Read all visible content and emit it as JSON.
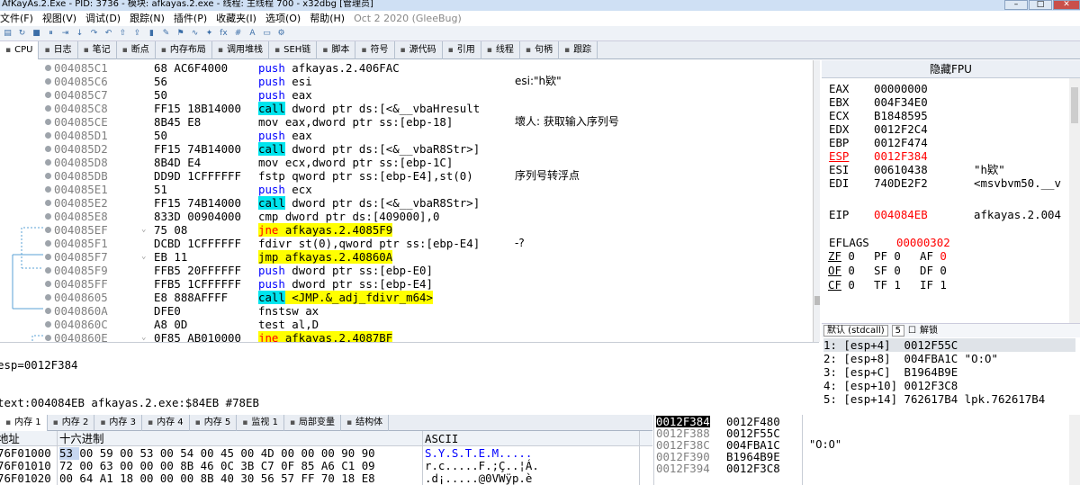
{
  "window": {
    "title": "AfKayAs.2.Exe - PID: 3736 - 模块: afkayas.2.exe - 线程: 主线程 700 - x32dbg [管理员]"
  },
  "menu": [
    "文件(F)",
    "视图(V)",
    "调试(D)",
    "跟踪(N)",
    "插件(P)",
    "收藏夹(I)",
    "选项(O)",
    "帮助(H)"
  ],
  "menu_date": "Oct 2 2020 (GleeBug)",
  "tabs": [
    {
      "label": "CPU",
      "icon": "cpu-icon"
    },
    {
      "label": "日志",
      "icon": "log-icon"
    },
    {
      "label": "笔记",
      "icon": "notes-icon"
    },
    {
      "label": "断点",
      "icon": "breakpoint-icon"
    },
    {
      "label": "内存布局",
      "icon": "memory-map-icon"
    },
    {
      "label": "调用堆栈",
      "icon": "call-stack-icon"
    },
    {
      "label": "SEH链",
      "icon": "seh-icon"
    },
    {
      "label": "脚本",
      "icon": "script-icon"
    },
    {
      "label": "符号",
      "icon": "symbol-icon"
    },
    {
      "label": "源代码",
      "icon": "source-icon"
    },
    {
      "label": "引用",
      "icon": "reference-icon"
    },
    {
      "label": "线程",
      "icon": "thread-icon"
    },
    {
      "label": "句柄",
      "icon": "handle-icon"
    },
    {
      "label": "跟踪",
      "icon": "trace-icon"
    }
  ],
  "disasm": [
    {
      "addr": "004085C1",
      "bytes": "68 AC6F4000",
      "kw": "push",
      "kwc": "kw-push",
      "ops": "afkayas.2.406FAC",
      "cmt": ""
    },
    {
      "addr": "004085C6",
      "bytes": "56",
      "kw": "push",
      "kwc": "kw-push",
      "ops": "esi",
      "cmt": "esi:\"h欵\""
    },
    {
      "addr": "004085C7",
      "bytes": "50",
      "kw": "push",
      "kwc": "kw-push",
      "ops": "eax",
      "cmt": ""
    },
    {
      "addr": "004085C8",
      "bytes": "FF15 18B14000",
      "kw": "call",
      "kwc": "kw-call",
      "ops": "dword ptr ds:[<&__vbaHresult",
      "cmt": ""
    },
    {
      "addr": "004085CE",
      "bytes": "8B45 E8",
      "kw": "mov",
      "kwc": "",
      "ops": "eax,dword ptr ss:[ebp-18]",
      "cmt": "壞人: 获取输入序列号"
    },
    {
      "addr": "004085D1",
      "bytes": "50",
      "kw": "push",
      "kwc": "kw-push",
      "ops": "eax",
      "cmt": ""
    },
    {
      "addr": "004085D2",
      "bytes": "FF15 74B14000",
      "kw": "call",
      "kwc": "kw-call",
      "ops": "dword ptr ds:[<&__vbaR8Str>]",
      "cmt": ""
    },
    {
      "addr": "004085D8",
      "bytes": "8B4D E4",
      "kw": "mov",
      "kwc": "",
      "ops": "ecx,dword ptr ss:[ebp-1C]",
      "cmt": ""
    },
    {
      "addr": "004085DB",
      "bytes": "DD9D 1CFFFFFF",
      "kw": "fstp",
      "kwc": "",
      "ops": "qword ptr ss:[ebp-E4],st(0)",
      "cmt": "序列号转浮点"
    },
    {
      "addr": "004085E1",
      "bytes": "51",
      "kw": "push",
      "kwc": "kw-push",
      "ops": "ecx",
      "cmt": ""
    },
    {
      "addr": "004085E2",
      "bytes": "FF15 74B14000",
      "kw": "call",
      "kwc": "kw-call",
      "ops": "dword ptr ds:[<&__vbaR8Str>]",
      "cmt": ""
    },
    {
      "addr": "004085E8",
      "bytes": "833D 00904000",
      "kw": "cmp",
      "kwc": "",
      "ops": "dword ptr ds:[409000],0",
      "cmt": ""
    },
    {
      "addr": "004085EF",
      "bytes": "75 08",
      "kw": "jne",
      "kwc": "kw-jne",
      "ops": "afkayas.2.4085F9",
      "cmt": ""
    },
    {
      "addr": "004085F1",
      "bytes": "DCBD 1CFFFFFF",
      "kw": "fdivr",
      "kwc": "",
      "ops": "st(0),qword ptr ss:[ebp-E4]",
      "cmt": "-?"
    },
    {
      "addr": "004085F7",
      "bytes": "EB 11",
      "kw": "jmp",
      "kwc": "kw-jmp",
      "ops": "afkayas.2.40860A",
      "cmt": ""
    },
    {
      "addr": "004085F9",
      "bytes": "FFB5 20FFFFFF",
      "kw": "push",
      "kwc": "kw-push",
      "ops": "dword ptr ss:[ebp-E0]",
      "cmt": ""
    },
    {
      "addr": "004085FF",
      "bytes": "FFB5 1CFFFFFF",
      "kw": "push",
      "kwc": "kw-push",
      "ops": "dword ptr ss:[ebp-E4]",
      "cmt": ""
    },
    {
      "addr": "00408605",
      "bytes": "E8 888AFFFF",
      "kw": "call",
      "kwc": "kw-call",
      "ops": "<JMP.&_adj_fdivr_m64>",
      "cmt": ""
    },
    {
      "addr": "0040860A",
      "bytes": "DFE0",
      "kw": "fnstsw",
      "kwc": "",
      "ops": "ax",
      "cmt": ""
    },
    {
      "addr": "0040860C",
      "bytes": "A8 0D",
      "kw": "test",
      "kwc": "",
      "ops": "al,D",
      "cmt": ""
    },
    {
      "addr": "0040860E",
      "bytes": "0F85 AB010000",
      "kw": "jne",
      "kwc": "kw-jne",
      "ops": "afkayas.2.4087BF",
      "cmt": ""
    }
  ],
  "fpu_header": "隐藏FPU",
  "registers": [
    {
      "name": "EAX",
      "value": "00000000",
      "extra": "",
      "red": false
    },
    {
      "name": "EBX",
      "value": "004F34E0",
      "extra": "",
      "red": false
    },
    {
      "name": "ECX",
      "value": "B1848595",
      "extra": "",
      "red": false
    },
    {
      "name": "EDX",
      "value": "0012F2C4",
      "extra": "",
      "red": false
    },
    {
      "name": "EBP",
      "value": "0012F474",
      "extra": "",
      "red": false
    },
    {
      "name": "ESP",
      "value": "0012F384",
      "extra": "",
      "red": true
    },
    {
      "name": "ESI",
      "value": "00610438",
      "extra": "\"h欵\"",
      "red": false
    },
    {
      "name": "EDI",
      "value": "740DE2F2",
      "extra": "<msvbvm50.__v",
      "red": false
    }
  ],
  "eip": {
    "name": "EIP",
    "value": "004084EB",
    "extra": "afkayas.2.004"
  },
  "eflags": {
    "name": "EFLAGS",
    "value": "00000302"
  },
  "flags": [
    [
      {
        "n": "ZF",
        "v": "0"
      },
      {
        "n": "PF",
        "v": "0"
      },
      {
        "n": "AF",
        "v": "0"
      }
    ],
    [
      {
        "n": "OF",
        "v": "0"
      },
      {
        "n": "SF",
        "v": "0"
      },
      {
        "n": "DF",
        "v": "0"
      }
    ],
    [
      {
        "n": "CF",
        "v": "0"
      },
      {
        "n": "TF",
        "v": "1"
      },
      {
        "n": "IF",
        "v": "1"
      }
    ]
  ],
  "callconv": {
    "label": "默认 (stdcall)",
    "count": "5",
    "unlock": "解锁"
  },
  "args": [
    "1: [esp+4]  0012F55C",
    "2: [esp+8]  004FBA1C \"O:O\"",
    "3: [esp+C]  B1964B9E",
    "4: [esp+10] 0012F3C8",
    "5: [esp+14] 762617B4 lpk.762617B4"
  ],
  "info": {
    "line1": "esp=0012F384",
    "line2": "text:004084EB afkayas.2.exe:$84EB #78EB"
  },
  "bottom_tabs": [
    {
      "label": "内存 1",
      "icon": "memory-icon"
    },
    {
      "label": "内存 2",
      "icon": "memory-icon"
    },
    {
      "label": "内存 3",
      "icon": "memory-icon"
    },
    {
      "label": "内存 4",
      "icon": "memory-icon"
    },
    {
      "label": "内存 5",
      "icon": "memory-icon"
    },
    {
      "label": "监视 1",
      "icon": "watch-icon"
    },
    {
      "label": "局部变量",
      "icon": "locals-icon"
    },
    {
      "label": "结构体",
      "icon": "struct-icon"
    }
  ],
  "dump_head": {
    "addr": "地址",
    "hex": "十六进制",
    "ascii": "ASCII"
  },
  "dump": [
    {
      "addr": "76F01000",
      "hex": "53 00 59 00 53 00 54 00 45 00 4D 00 00 00 90 90",
      "ascii": "S.Y.S.T.E.M....."
    },
    {
      "addr": "76F01010",
      "hex": "72 00 63 00 00 00 8B 46 0C 3B C7 0F 85 A6 C1 09",
      "ascii": "r.c.....F.;Ç..¦Á."
    },
    {
      "addr": "76F01020",
      "hex": "00 64 A1 18 00 00 00 8B 40 30 56 57 FF 70 18 E8",
      "ascii": ".d¡.....@0VWÿp.è"
    }
  ],
  "stack": [
    {
      "addr": "0012F384",
      "val": "0012F480",
      "cmt": ""
    },
    {
      "addr": "0012F388",
      "val": "0012F55C",
      "cmt": ""
    },
    {
      "addr": "0012F38C",
      "val": "004FBA1C",
      "cmt": "\"O:O\""
    },
    {
      "addr": "0012F390",
      "val": "B1964B9E",
      "cmt": ""
    },
    {
      "addr": "0012F394",
      "val": "0012F3C8",
      "cmt": ""
    }
  ],
  "colors": {
    "call_bg": "#00e5ee",
    "jump_bg": "#ffff00",
    "push": "#0000ff",
    "red": "#ff0000"
  }
}
